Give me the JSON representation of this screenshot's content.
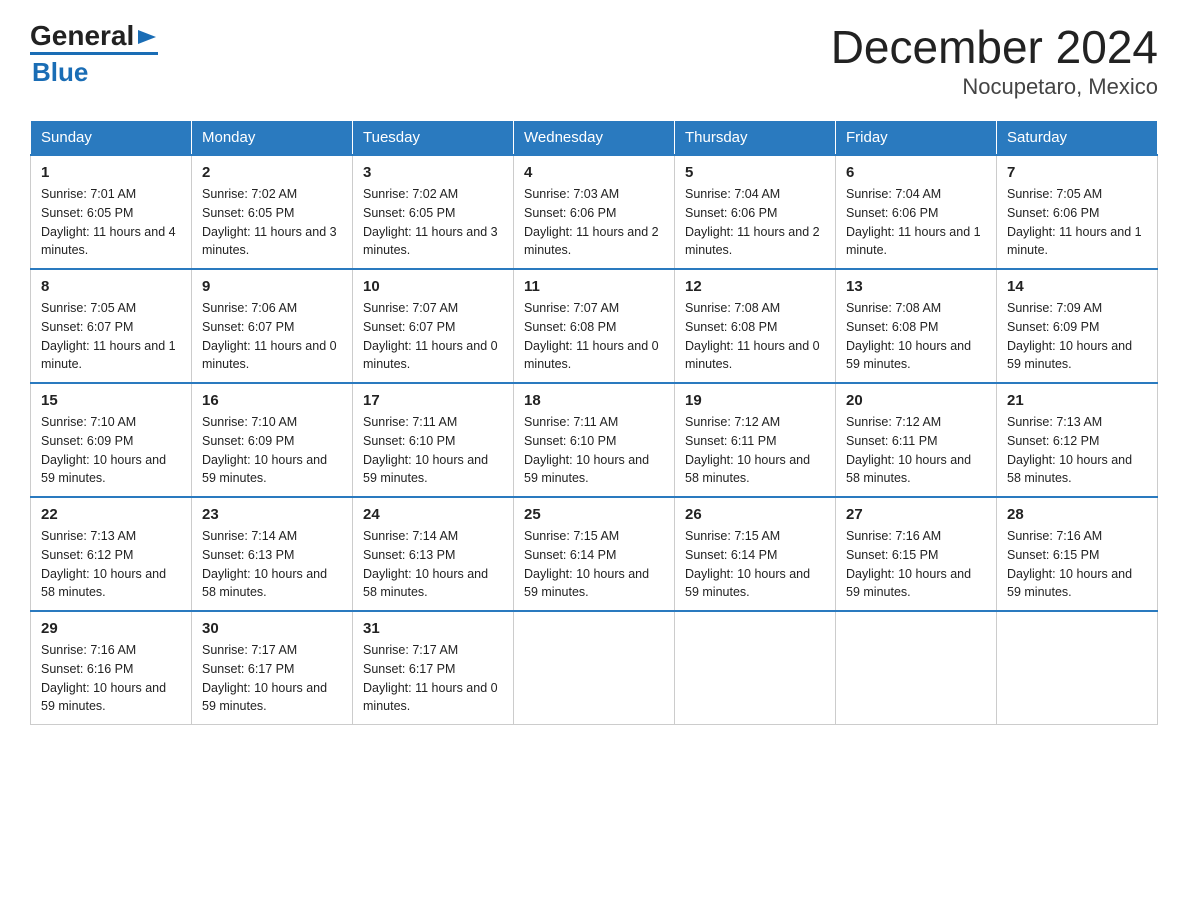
{
  "header": {
    "title": "December 2024",
    "subtitle": "Nocupetaro, Mexico",
    "logo_general": "General",
    "logo_blue": "Blue"
  },
  "days_of_week": [
    "Sunday",
    "Monday",
    "Tuesday",
    "Wednesday",
    "Thursday",
    "Friday",
    "Saturday"
  ],
  "weeks": [
    [
      {
        "day": "1",
        "sunrise": "7:01 AM",
        "sunset": "6:05 PM",
        "daylight": "11 hours and 4 minutes."
      },
      {
        "day": "2",
        "sunrise": "7:02 AM",
        "sunset": "6:05 PM",
        "daylight": "11 hours and 3 minutes."
      },
      {
        "day": "3",
        "sunrise": "7:02 AM",
        "sunset": "6:05 PM",
        "daylight": "11 hours and 3 minutes."
      },
      {
        "day": "4",
        "sunrise": "7:03 AM",
        "sunset": "6:06 PM",
        "daylight": "11 hours and 2 minutes."
      },
      {
        "day": "5",
        "sunrise": "7:04 AM",
        "sunset": "6:06 PM",
        "daylight": "11 hours and 2 minutes."
      },
      {
        "day": "6",
        "sunrise": "7:04 AM",
        "sunset": "6:06 PM",
        "daylight": "11 hours and 1 minute."
      },
      {
        "day": "7",
        "sunrise": "7:05 AM",
        "sunset": "6:06 PM",
        "daylight": "11 hours and 1 minute."
      }
    ],
    [
      {
        "day": "8",
        "sunrise": "7:05 AM",
        "sunset": "6:07 PM",
        "daylight": "11 hours and 1 minute."
      },
      {
        "day": "9",
        "sunrise": "7:06 AM",
        "sunset": "6:07 PM",
        "daylight": "11 hours and 0 minutes."
      },
      {
        "day": "10",
        "sunrise": "7:07 AM",
        "sunset": "6:07 PM",
        "daylight": "11 hours and 0 minutes."
      },
      {
        "day": "11",
        "sunrise": "7:07 AM",
        "sunset": "6:08 PM",
        "daylight": "11 hours and 0 minutes."
      },
      {
        "day": "12",
        "sunrise": "7:08 AM",
        "sunset": "6:08 PM",
        "daylight": "11 hours and 0 minutes."
      },
      {
        "day": "13",
        "sunrise": "7:08 AM",
        "sunset": "6:08 PM",
        "daylight": "10 hours and 59 minutes."
      },
      {
        "day": "14",
        "sunrise": "7:09 AM",
        "sunset": "6:09 PM",
        "daylight": "10 hours and 59 minutes."
      }
    ],
    [
      {
        "day": "15",
        "sunrise": "7:10 AM",
        "sunset": "6:09 PM",
        "daylight": "10 hours and 59 minutes."
      },
      {
        "day": "16",
        "sunrise": "7:10 AM",
        "sunset": "6:09 PM",
        "daylight": "10 hours and 59 minutes."
      },
      {
        "day": "17",
        "sunrise": "7:11 AM",
        "sunset": "6:10 PM",
        "daylight": "10 hours and 59 minutes."
      },
      {
        "day": "18",
        "sunrise": "7:11 AM",
        "sunset": "6:10 PM",
        "daylight": "10 hours and 59 minutes."
      },
      {
        "day": "19",
        "sunrise": "7:12 AM",
        "sunset": "6:11 PM",
        "daylight": "10 hours and 58 minutes."
      },
      {
        "day": "20",
        "sunrise": "7:12 AM",
        "sunset": "6:11 PM",
        "daylight": "10 hours and 58 minutes."
      },
      {
        "day": "21",
        "sunrise": "7:13 AM",
        "sunset": "6:12 PM",
        "daylight": "10 hours and 58 minutes."
      }
    ],
    [
      {
        "day": "22",
        "sunrise": "7:13 AM",
        "sunset": "6:12 PM",
        "daylight": "10 hours and 58 minutes."
      },
      {
        "day": "23",
        "sunrise": "7:14 AM",
        "sunset": "6:13 PM",
        "daylight": "10 hours and 58 minutes."
      },
      {
        "day": "24",
        "sunrise": "7:14 AM",
        "sunset": "6:13 PM",
        "daylight": "10 hours and 58 minutes."
      },
      {
        "day": "25",
        "sunrise": "7:15 AM",
        "sunset": "6:14 PM",
        "daylight": "10 hours and 59 minutes."
      },
      {
        "day": "26",
        "sunrise": "7:15 AM",
        "sunset": "6:14 PM",
        "daylight": "10 hours and 59 minutes."
      },
      {
        "day": "27",
        "sunrise": "7:16 AM",
        "sunset": "6:15 PM",
        "daylight": "10 hours and 59 minutes."
      },
      {
        "day": "28",
        "sunrise": "7:16 AM",
        "sunset": "6:15 PM",
        "daylight": "10 hours and 59 minutes."
      }
    ],
    [
      {
        "day": "29",
        "sunrise": "7:16 AM",
        "sunset": "6:16 PM",
        "daylight": "10 hours and 59 minutes."
      },
      {
        "day": "30",
        "sunrise": "7:17 AM",
        "sunset": "6:17 PM",
        "daylight": "10 hours and 59 minutes."
      },
      {
        "day": "31",
        "sunrise": "7:17 AM",
        "sunset": "6:17 PM",
        "daylight": "11 hours and 0 minutes."
      },
      {
        "day": "",
        "sunrise": "",
        "sunset": "",
        "daylight": ""
      },
      {
        "day": "",
        "sunrise": "",
        "sunset": "",
        "daylight": ""
      },
      {
        "day": "",
        "sunrise": "",
        "sunset": "",
        "daylight": ""
      },
      {
        "day": "",
        "sunrise": "",
        "sunset": "",
        "daylight": ""
      }
    ]
  ],
  "label_sunrise": "Sunrise:",
  "label_sunset": "Sunset:",
  "label_daylight": "Daylight:"
}
